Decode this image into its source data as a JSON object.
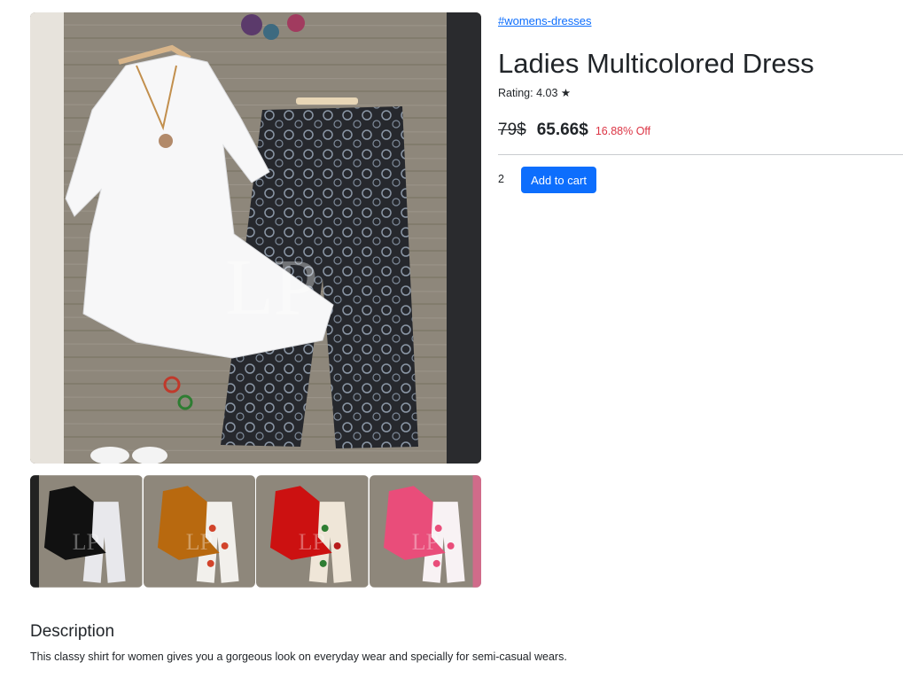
{
  "product": {
    "category_link": "#womens-dresses",
    "title": "Ladies Multicolored Dress",
    "rating_label": "Rating:",
    "rating_value": "4.03",
    "rating_star": "★",
    "old_price": "79$",
    "new_price": "65.66$",
    "discount": "16.88% Off",
    "quantity": "2",
    "add_to_cart_label": "Add to cart"
  },
  "gallery": {
    "main_top_color": "#ffffff",
    "main_bottom_color": "#2a2d33",
    "thumbnails": [
      {
        "name": "black",
        "top_color": "#111111",
        "bottom_color": "#e8e8ec"
      },
      {
        "name": "mustard",
        "top_color": "#b8690f",
        "bottom_color": "#f2f0ec"
      },
      {
        "name": "red",
        "top_color": "#cc1111",
        "bottom_color": "#efe6d8"
      },
      {
        "name": "pink",
        "top_color": "#e94d7a",
        "bottom_color": "#f8f2f4"
      }
    ],
    "watermark_text": "LP"
  },
  "description": {
    "heading": "Description",
    "text": "This classy shirt for women gives you a gorgeous look on everyday wear and specially for semi-casual wears."
  },
  "colors": {
    "accent": "#0d6efd",
    "discount": "#dc3545",
    "text": "#212529"
  }
}
